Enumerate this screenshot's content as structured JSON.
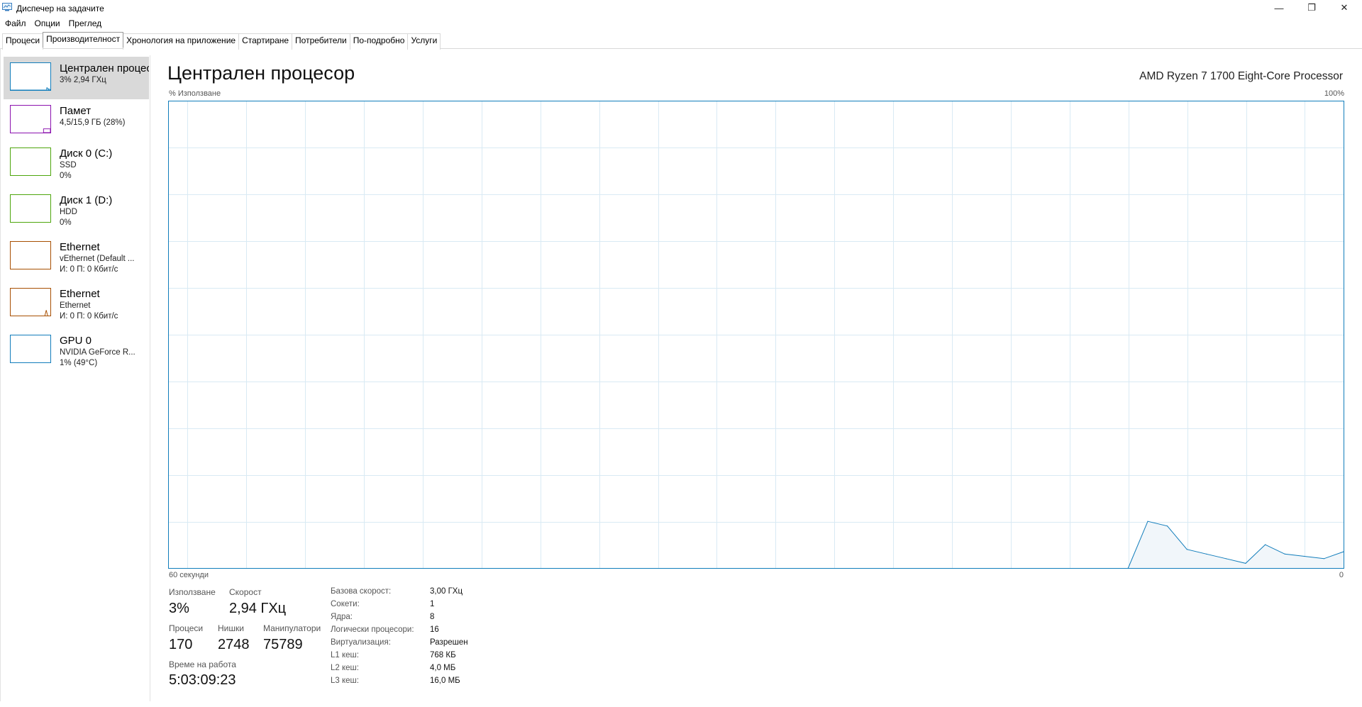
{
  "window": {
    "title": "Диспечер на задачите",
    "minimize": "—",
    "restore": "❐",
    "close": "✕"
  },
  "menu": [
    "Файл",
    "Опции",
    "Преглед"
  ],
  "tabs": [
    "Процеси",
    "Производителност",
    "Хронология на приложение",
    "Стартиране",
    "Потребители",
    "По-подробно",
    "Услуги"
  ],
  "active_tab": 1,
  "sidebar": {
    "items": [
      {
        "title": "Централен процесор",
        "line1": "3%  2,94 ГХц",
        "line2": "",
        "color": "#117dbb",
        "selected": true,
        "spark": [
          0,
          0,
          0,
          0,
          0,
          0,
          0,
          0,
          0,
          0,
          0,
          0,
          0,
          0,
          0,
          0,
          0,
          0,
          0,
          0,
          0,
          0,
          0,
          0,
          0,
          0,
          0,
          0,
          0,
          0,
          0,
          0,
          0,
          0,
          0,
          0,
          0,
          0,
          0,
          0,
          0,
          0,
          0,
          0,
          0,
          0,
          0,
          0,
          0,
          0,
          0,
          0,
          0,
          0,
          0,
          0,
          0,
          0,
          0,
          0,
          0,
          0,
          0,
          0,
          0,
          0,
          0,
          0,
          0,
          0,
          0,
          0,
          0,
          0,
          0,
          0,
          0,
          0,
          0,
          0,
          0,
          0,
          0,
          0,
          0,
          0,
          0,
          0,
          0,
          0,
          0,
          0,
          0,
          0,
          0,
          0,
          10,
          6,
          3,
          2,
          1,
          5,
          3,
          2,
          1,
          3
        ]
      },
      {
        "title": "Памет",
        "line1": "4,5/15,9 ГБ (28%)",
        "line2": "",
        "color": "#8b12ae",
        "selected": false,
        "level": 0.28
      },
      {
        "title": "Диск 0 (C:)",
        "line1": "SSD",
        "line2": "0%",
        "color": "#4da60c",
        "selected": false
      },
      {
        "title": "Диск 1 (D:)",
        "line1": "HDD",
        "line2": "0%",
        "color": "#4da60c",
        "selected": false
      },
      {
        "title": "Ethernet",
        "line1": "vEthernet (Default ...",
        "line2": "И: 0 П: 0 Кбит/с",
        "color": "#a74f01",
        "selected": false
      },
      {
        "title": "Ethernet",
        "line1": "Ethernet",
        "line2": "И: 0 П: 0 Кбит/с",
        "color": "#a74f01",
        "selected": false,
        "spike": true
      },
      {
        "title": "GPU 0",
        "line1": "NVIDIA GeForce R...",
        "line2": "1% (49°C)",
        "color": "#117dbb",
        "selected": false
      }
    ]
  },
  "main": {
    "title": "Централен процесор",
    "cpu_model": "AMD Ryzen 7 1700 Eight-Core Processor",
    "axis_top_left": "% Използване",
    "axis_top_right": "100%",
    "axis_bottom_left": "60 секунди",
    "axis_bottom_right": "0"
  },
  "chart_data": {
    "type": "area",
    "title": "",
    "xlabel": "60 секунди",
    "ylabel": "% Използване",
    "xlim": [
      60,
      0
    ],
    "ylim": [
      0,
      100
    ],
    "grid": true,
    "color": "#117dbb",
    "x": [
      11,
      10,
      9,
      8,
      7,
      6,
      5,
      4,
      3,
      2,
      1,
      0
    ],
    "values": [
      0,
      10,
      9,
      4,
      3,
      2,
      1,
      5,
      3,
      2.5,
      2,
      3.5
    ]
  },
  "stats": {
    "usage_label": "Използване",
    "usage": "3%",
    "speed_label": "Скорост",
    "speed": "2,94 ГХц",
    "processes_label": "Процеси",
    "processes": "170",
    "threads_label": "Нишки",
    "threads": "2748",
    "handles_label": "Манипулатори",
    "handles": "75789",
    "uptime_label": "Време на работа",
    "uptime": "5:03:09:23"
  },
  "specs": [
    {
      "label": "Базова скорост:",
      "value": "3,00 ГХц"
    },
    {
      "label": "Сокети:",
      "value": "1"
    },
    {
      "label": "Ядра:",
      "value": "8"
    },
    {
      "label": "Логически процесори:",
      "value": "16"
    },
    {
      "label": "Виртуализация:",
      "value": "Разрешен"
    },
    {
      "label": "L1 кеш:",
      "value": "768 КБ"
    },
    {
      "label": "L2 кеш:",
      "value": "4,0 МБ"
    },
    {
      "label": "L3 кеш:",
      "value": "16,0 МБ"
    }
  ]
}
